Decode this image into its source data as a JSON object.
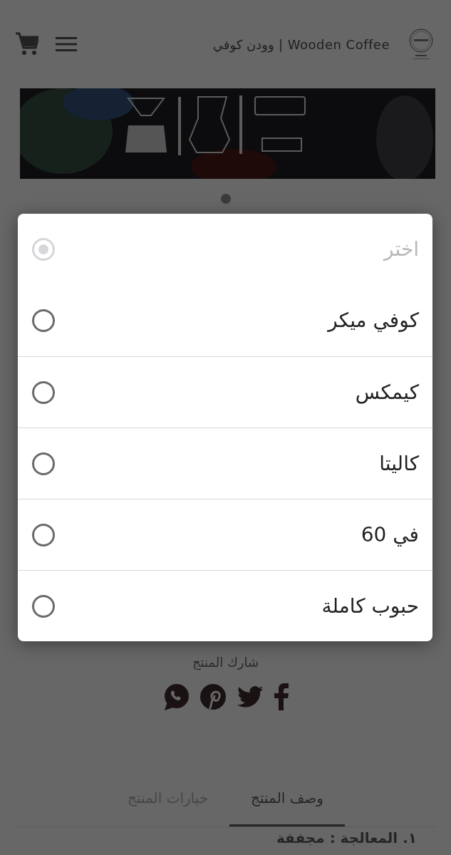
{
  "header": {
    "title": "Wooden Coffee | وودن كوفي"
  },
  "carousel": {
    "kind": "picture",
    "dots": [
      {
        "selected": true
      }
    ]
  },
  "dialog": {
    "options": [
      {
        "label": "اختر",
        "selected": true,
        "disabled": true
      },
      {
        "label": "كوفي ميكر",
        "selected": false,
        "disabled": false
      },
      {
        "label": "كيمكس",
        "selected": false,
        "disabled": false
      },
      {
        "label": "كاليتا",
        "selected": false,
        "disabled": false
      },
      {
        "label": "في 60",
        "selected": false,
        "disabled": false
      },
      {
        "label": "حبوب كاملة",
        "selected": false,
        "disabled": false
      }
    ]
  },
  "share": {
    "label": "شارك المنتج",
    "links": [
      {
        "kind": "facebook"
      },
      {
        "kind": "twitter"
      },
      {
        "kind": "pinterest"
      },
      {
        "kind": "whatsapp"
      }
    ]
  },
  "tabs": [
    {
      "label": "وصف المنتج",
      "selected": true
    },
    {
      "label": "خيارات المنتج",
      "selected": false
    }
  ],
  "description": {
    "first_line": "١. المعالجة : مجففة"
  }
}
